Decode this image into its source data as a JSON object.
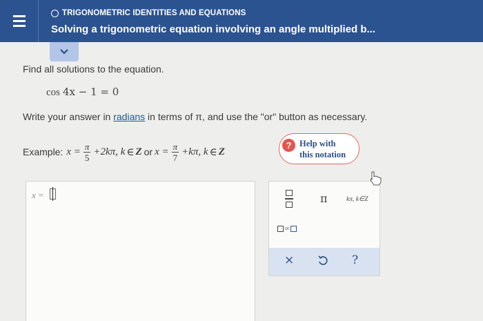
{
  "header": {
    "section": "TRIGONOMETRIC IDENTITIES AND EQUATIONS",
    "title": "Solving a trigonometric equation involving an angle multiplied b..."
  },
  "problem": {
    "prompt": "Find all solutions to the equation.",
    "equation_fn": "cos",
    "equation_body": "4x − 1 = 0",
    "instruction_before": "Write your answer in ",
    "instruction_link": "radians",
    "instruction_after": " in terms of π, and use the \"or\" button as necessary."
  },
  "example": {
    "label": "Example:",
    "x1": "x =",
    "frac1_num": "π",
    "frac1_den": "5",
    "term1": "+2kπ, k",
    "in1": "∈",
    "set1": "Z",
    "or_word": " or ",
    "x2": "x =",
    "frac2_num": "π",
    "frac2_den": "7",
    "term2": "+kπ, k",
    "in2": "∈",
    "set2": "Z"
  },
  "help": {
    "icon_glyph": "?",
    "line1": "Help with",
    "line2": "this notation"
  },
  "answer": {
    "x_label": "x ="
  },
  "keypad": {
    "pi_label": "π",
    "kpi_label": "kπ, k∈Z",
    "or_label": "or",
    "clear_label": "×",
    "undo_label": "↺",
    "help_label": "?"
  },
  "colors": {
    "header_bg": "#2b5390",
    "link": "#1f57a8",
    "help_accent": "#e5554c",
    "action_bar": "#d9e2f1"
  }
}
